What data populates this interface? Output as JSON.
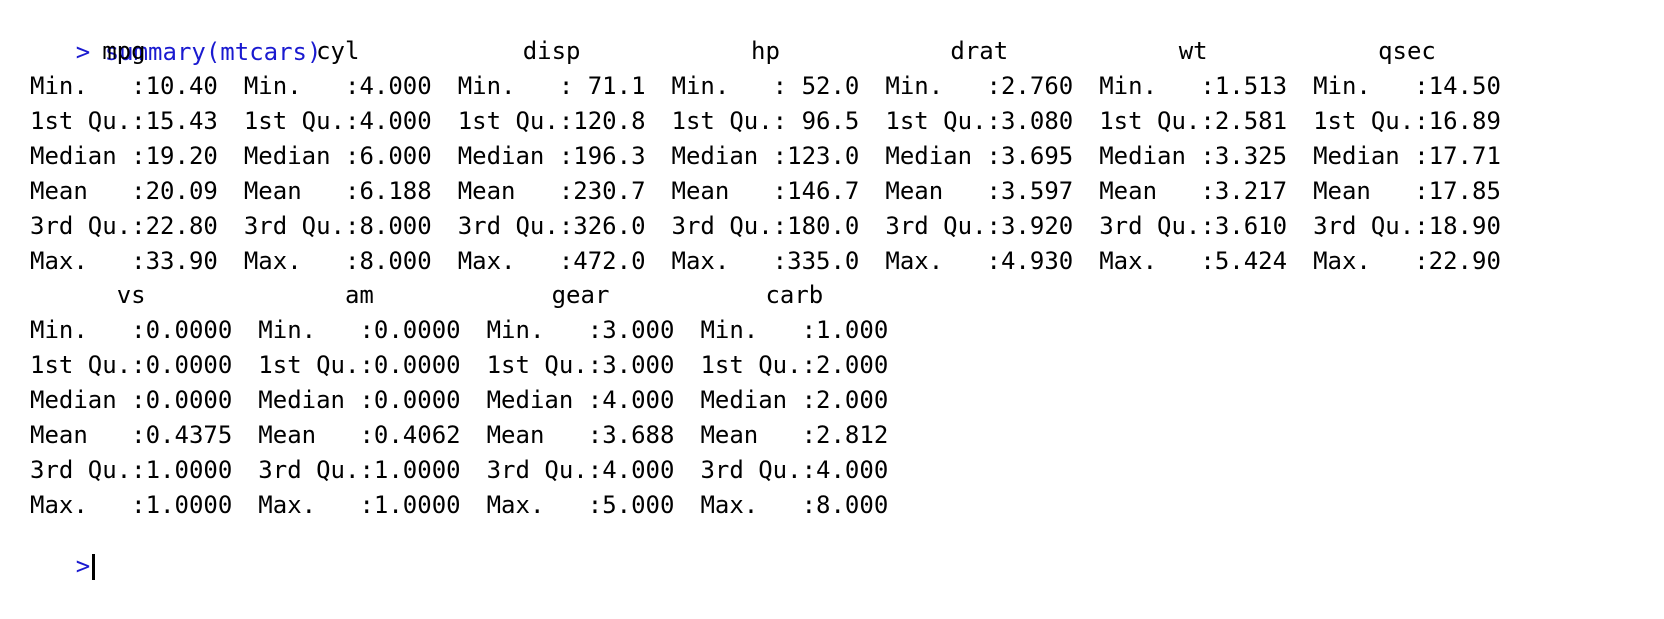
{
  "console": {
    "prompt": ">",
    "command": "summary(mtcars)",
    "block1": [
      {
        "name": "mpg",
        "rows": [
          "Min.   :10.40",
          "1st Qu.:15.43",
          "Median :19.20",
          "Mean   :20.09",
          "3rd Qu.:22.80",
          "Max.   :33.90"
        ]
      },
      {
        "name": "cyl",
        "rows": [
          "Min.   :4.000",
          "1st Qu.:4.000",
          "Median :6.000",
          "Mean   :6.188",
          "3rd Qu.:8.000",
          "Max.   :8.000"
        ]
      },
      {
        "name": "disp",
        "rows": [
          "Min.   : 71.1",
          "1st Qu.:120.8",
          "Median :196.3",
          "Mean   :230.7",
          "3rd Qu.:326.0",
          "Max.   :472.0"
        ]
      },
      {
        "name": "hp",
        "rows": [
          "Min.   : 52.0",
          "1st Qu.: 96.5",
          "Median :123.0",
          "Mean   :146.7",
          "3rd Qu.:180.0",
          "Max.   :335.0"
        ]
      },
      {
        "name": "drat",
        "rows": [
          "Min.   :2.760",
          "1st Qu.:3.080",
          "Median :3.695",
          "Mean   :3.597",
          "3rd Qu.:3.920",
          "Max.   :4.930"
        ]
      },
      {
        "name": "wt",
        "rows": [
          "Min.   :1.513",
          "1st Qu.:2.581",
          "Median :3.325",
          "Mean   :3.217",
          "3rd Qu.:3.610",
          "Max.   :5.424"
        ]
      },
      {
        "name": "qsec",
        "rows": [
          "Min.   :14.50",
          "1st Qu.:16.89",
          "Median :17.71",
          "Mean   :17.85",
          "3rd Qu.:18.90",
          "Max.   :22.90"
        ]
      }
    ],
    "block2": [
      {
        "name": "vs",
        "rows": [
          "Min.   :0.0000",
          "1st Qu.:0.0000",
          "Median :0.0000",
          "Mean   :0.4375",
          "3rd Qu.:1.0000",
          "Max.   :1.0000"
        ]
      },
      {
        "name": "am",
        "rows": [
          "Min.   :0.0000",
          "1st Qu.:0.0000",
          "Median :0.0000",
          "Mean   :0.4062",
          "3rd Qu.:1.0000",
          "Max.   :1.0000"
        ]
      },
      {
        "name": "gear",
        "rows": [
          "Min.   :3.000",
          "1st Qu.:3.000",
          "Median :4.000",
          "Mean   :3.688",
          "3rd Qu.:4.000",
          "Max.   :5.000"
        ]
      },
      {
        "name": "carb",
        "rows": [
          "Min.   :1.000",
          "1st Qu.:2.000",
          "Median :2.000",
          "Mean   :2.812",
          "3rd Qu.:4.000",
          "Max.   :8.000"
        ]
      }
    ]
  }
}
